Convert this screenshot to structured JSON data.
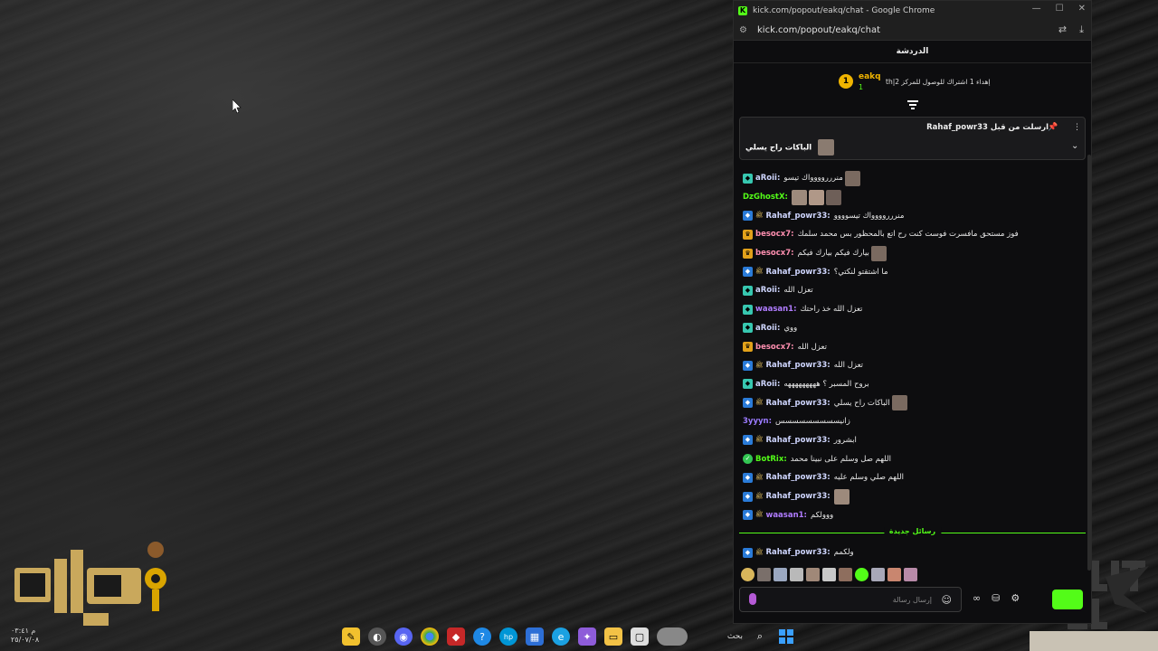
{
  "browser": {
    "title": "kick.com/popout/eakq/chat - Google Chrome",
    "url": "kick.com/popout/eakq/chat"
  },
  "chat": {
    "header": "الدردشة",
    "leaderboard": {
      "rank": "1",
      "name": "eakq",
      "count": "1",
      "goal_text": "th|إهداء 1 اشتراك للوصول للمركز 2"
    },
    "pinned": {
      "header": "ارسلت من قبل Rahaf_powr33",
      "text": "الباكات راح يسلي"
    },
    "messages": [
      {
        "badge": "teal",
        "user": "aRoii:",
        "color": "c-light",
        "text": "منررروووواك تيسو",
        "emotes": 1
      },
      {
        "badge": "",
        "user": "DzGhostX:",
        "color": "c-green",
        "text": "",
        "emotes": 3
      },
      {
        "badge": "blue",
        "user": "Rahaf_powr33:",
        "color": "c-light",
        "text": "منررروووواك تيسوووو",
        "emotes": 0
      },
      {
        "badge": "gold",
        "user": "besocx7:",
        "color": "c-pink",
        "text": "فوز مستحق مافسرت فوست كنت رح اتع بالمحظور بس محمد سلمك",
        "emotes": 0
      },
      {
        "badge": "gold",
        "user": "besocx7:",
        "color": "c-pink",
        "text": "بيارك فيكم بيارك فيكم",
        "emotes": 1
      },
      {
        "badge": "blue",
        "user": "Rahaf_powr33:",
        "color": "c-light",
        "text": "ما اشتقتو لنكتي؟",
        "emotes": 0
      },
      {
        "badge": "teal",
        "user": "aRoii:",
        "color": "c-light",
        "text": "تعزل الله",
        "emotes": 0
      },
      {
        "badge": "teal",
        "user": "waasan1:",
        "color": "c-purple",
        "text": "تعزل الله خذ راحتك",
        "emotes": 0
      },
      {
        "badge": "teal",
        "user": "aRoii:",
        "color": "c-light",
        "text": "ووي",
        "emotes": 0
      },
      {
        "badge": "gold",
        "user": "besocx7:",
        "color": "c-pink",
        "text": "تعزل الله",
        "emotes": 0
      },
      {
        "badge": "blue",
        "user": "Rahaf_powr33:",
        "color": "c-light",
        "text": "تعزل الله",
        "emotes": 0
      },
      {
        "badge": "teal",
        "user": "aRoii:",
        "color": "c-light",
        "text": "بروح المسبر ؟ هههههههههه",
        "emotes": 0
      },
      {
        "badge": "blue",
        "user": "Rahaf_powr33:",
        "color": "c-light",
        "text": "الباكات راح يسلي",
        "emotes": 1
      },
      {
        "badge": "",
        "user": "3yyyn:",
        "color": "c-violet",
        "text": "زانيسسسسسسسسس",
        "emotes": 0
      },
      {
        "badge": "blue",
        "user": "Rahaf_powr33:",
        "color": "c-light",
        "text": "ابشرور",
        "emotes": 0
      },
      {
        "badge": "green",
        "user": "BotRix:",
        "color": "c-green",
        "text": "اللهم صل وسلم على نبينا محمد",
        "emotes": 0
      },
      {
        "badge": "blue",
        "user": "Rahaf_powr33:",
        "color": "c-light",
        "text": "اللهم صلي وسلم عليه",
        "emotes": 0
      },
      {
        "badge": "blue",
        "user": "Rahaf_powr33:",
        "color": "c-light",
        "text": "",
        "emotes": 1
      },
      {
        "badge": "blue",
        "user": "waasan1:",
        "color": "c-purple",
        "text": "ووولكم",
        "emotes": 0
      }
    ],
    "new_messages_label": "رسائل جديدة",
    "last_message": {
      "badge": "blue",
      "user": "Rahaf_powr33:",
      "text": "ولكمم"
    },
    "input_placeholder": "إرسال رسالة",
    "colors": {
      "accent": "#53fc18",
      "background": "#0d0d0f"
    }
  },
  "taskbar": {
    "search_label": "بحث"
  },
  "desktop": {
    "clock_time": "م ٠٣:٤١",
    "clock_date": "٢٥/٠٧/٠٨"
  }
}
